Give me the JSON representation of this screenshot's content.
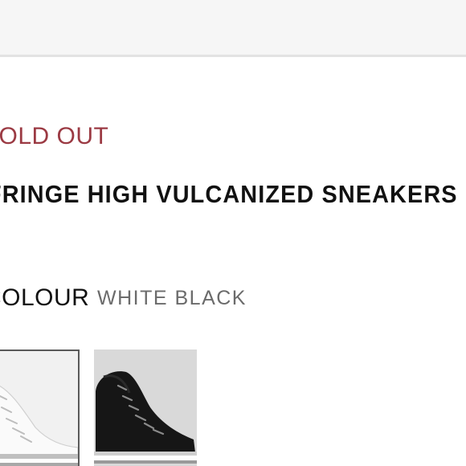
{
  "status": {
    "text": "SOLD OUT",
    "color": "#9b3a43"
  },
  "product": {
    "title": "FRINGE HIGH VULCANIZED SNEAKERS"
  },
  "colour": {
    "label": "COLOUR",
    "selected_value": "WHITE BLACK",
    "swatches": [
      {
        "name": "white",
        "selected": true
      },
      {
        "name": "black",
        "selected": false
      }
    ]
  }
}
